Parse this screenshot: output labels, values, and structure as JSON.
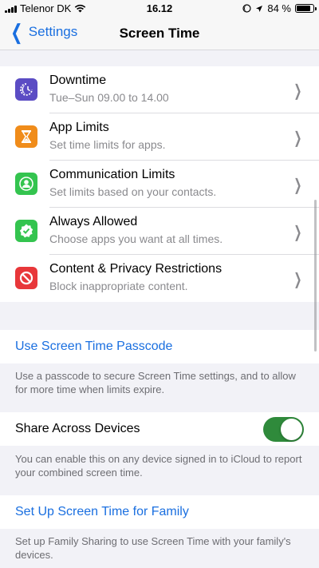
{
  "status_bar": {
    "carrier": "Telenor DK",
    "time": "16.12",
    "battery_percent": "84 %",
    "battery_level": 0.84
  },
  "nav": {
    "back_label": "Settings",
    "title": "Screen Time"
  },
  "items": [
    {
      "title": "Downtime",
      "subtitle": "Tue–Sun 09.00 to 14.00",
      "icon": "moon-clock-icon",
      "color": "#5b4cc4"
    },
    {
      "title": "App Limits",
      "subtitle": "Set time limits for apps.",
      "icon": "hourglass-icon",
      "color": "#f08c1a"
    },
    {
      "title": "Communication Limits",
      "subtitle": "Set limits based on your contacts.",
      "icon": "person-circle-icon",
      "color": "#34c44f"
    },
    {
      "title": "Always Allowed",
      "subtitle": "Choose apps you want at all times.",
      "icon": "checkmark-badge-icon",
      "color": "#34c44f"
    },
    {
      "title": "Content & Privacy Restrictions",
      "subtitle": "Block inappropriate content.",
      "icon": "no-entry-icon",
      "color": "#e8373a"
    }
  ],
  "passcode": {
    "label": "Use Screen Time Passcode",
    "footnote": "Use a passcode to secure Screen Time settings, and to allow for more time when limits expire."
  },
  "share": {
    "label": "Share Across Devices",
    "enabled": true,
    "footnote": "You can enable this on any device signed in to iCloud to report your combined screen time."
  },
  "family": {
    "label": "Set Up Screen Time for Family",
    "footnote": "Set up Family Sharing to use Screen Time with your family's devices."
  },
  "colors": {
    "accent": "#1a6fe0",
    "toggle_on": "#2f8a3b"
  }
}
